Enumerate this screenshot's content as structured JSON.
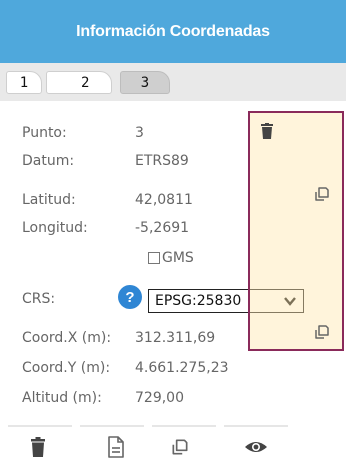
{
  "header": {
    "title": "Información Coordenadas"
  },
  "tabs": [
    {
      "label": "1"
    },
    {
      "label": "2"
    },
    {
      "label": "3"
    }
  ],
  "active_tab": "3",
  "fields": {
    "punto": {
      "label": "Punto:",
      "value": "3"
    },
    "datum": {
      "label": "Datum:",
      "value": "ETRS89"
    },
    "latitud": {
      "label": "Latitud:",
      "value": "42,0811"
    },
    "longitud": {
      "label": "Longitud:",
      "value": "-5,2691"
    },
    "gms": {
      "label": "GMS",
      "checked": false
    },
    "crs": {
      "label": "CRS:",
      "help": "?",
      "selected": "EPSG:25830"
    },
    "coordx": {
      "label": "Coord.X (m):",
      "value": "312.311,69"
    },
    "coordy": {
      "label": "Coord.Y (m):",
      "value": "4.661.275,23"
    },
    "altitud": {
      "label": "Altitud (m):",
      "value": "729,00"
    }
  },
  "toolbar": {
    "buttons": [
      {
        "name": "delete",
        "icon": "trash-icon"
      },
      {
        "name": "document",
        "icon": "document-icon"
      },
      {
        "name": "copy",
        "icon": "copy-icon"
      },
      {
        "name": "view",
        "icon": "eye-icon"
      }
    ]
  },
  "colors": {
    "header": "#4fa8dc",
    "highlight_border": "#8a2a5a",
    "highlight_fill": "#ffe6af",
    "help_icon": "#2f86d4"
  }
}
